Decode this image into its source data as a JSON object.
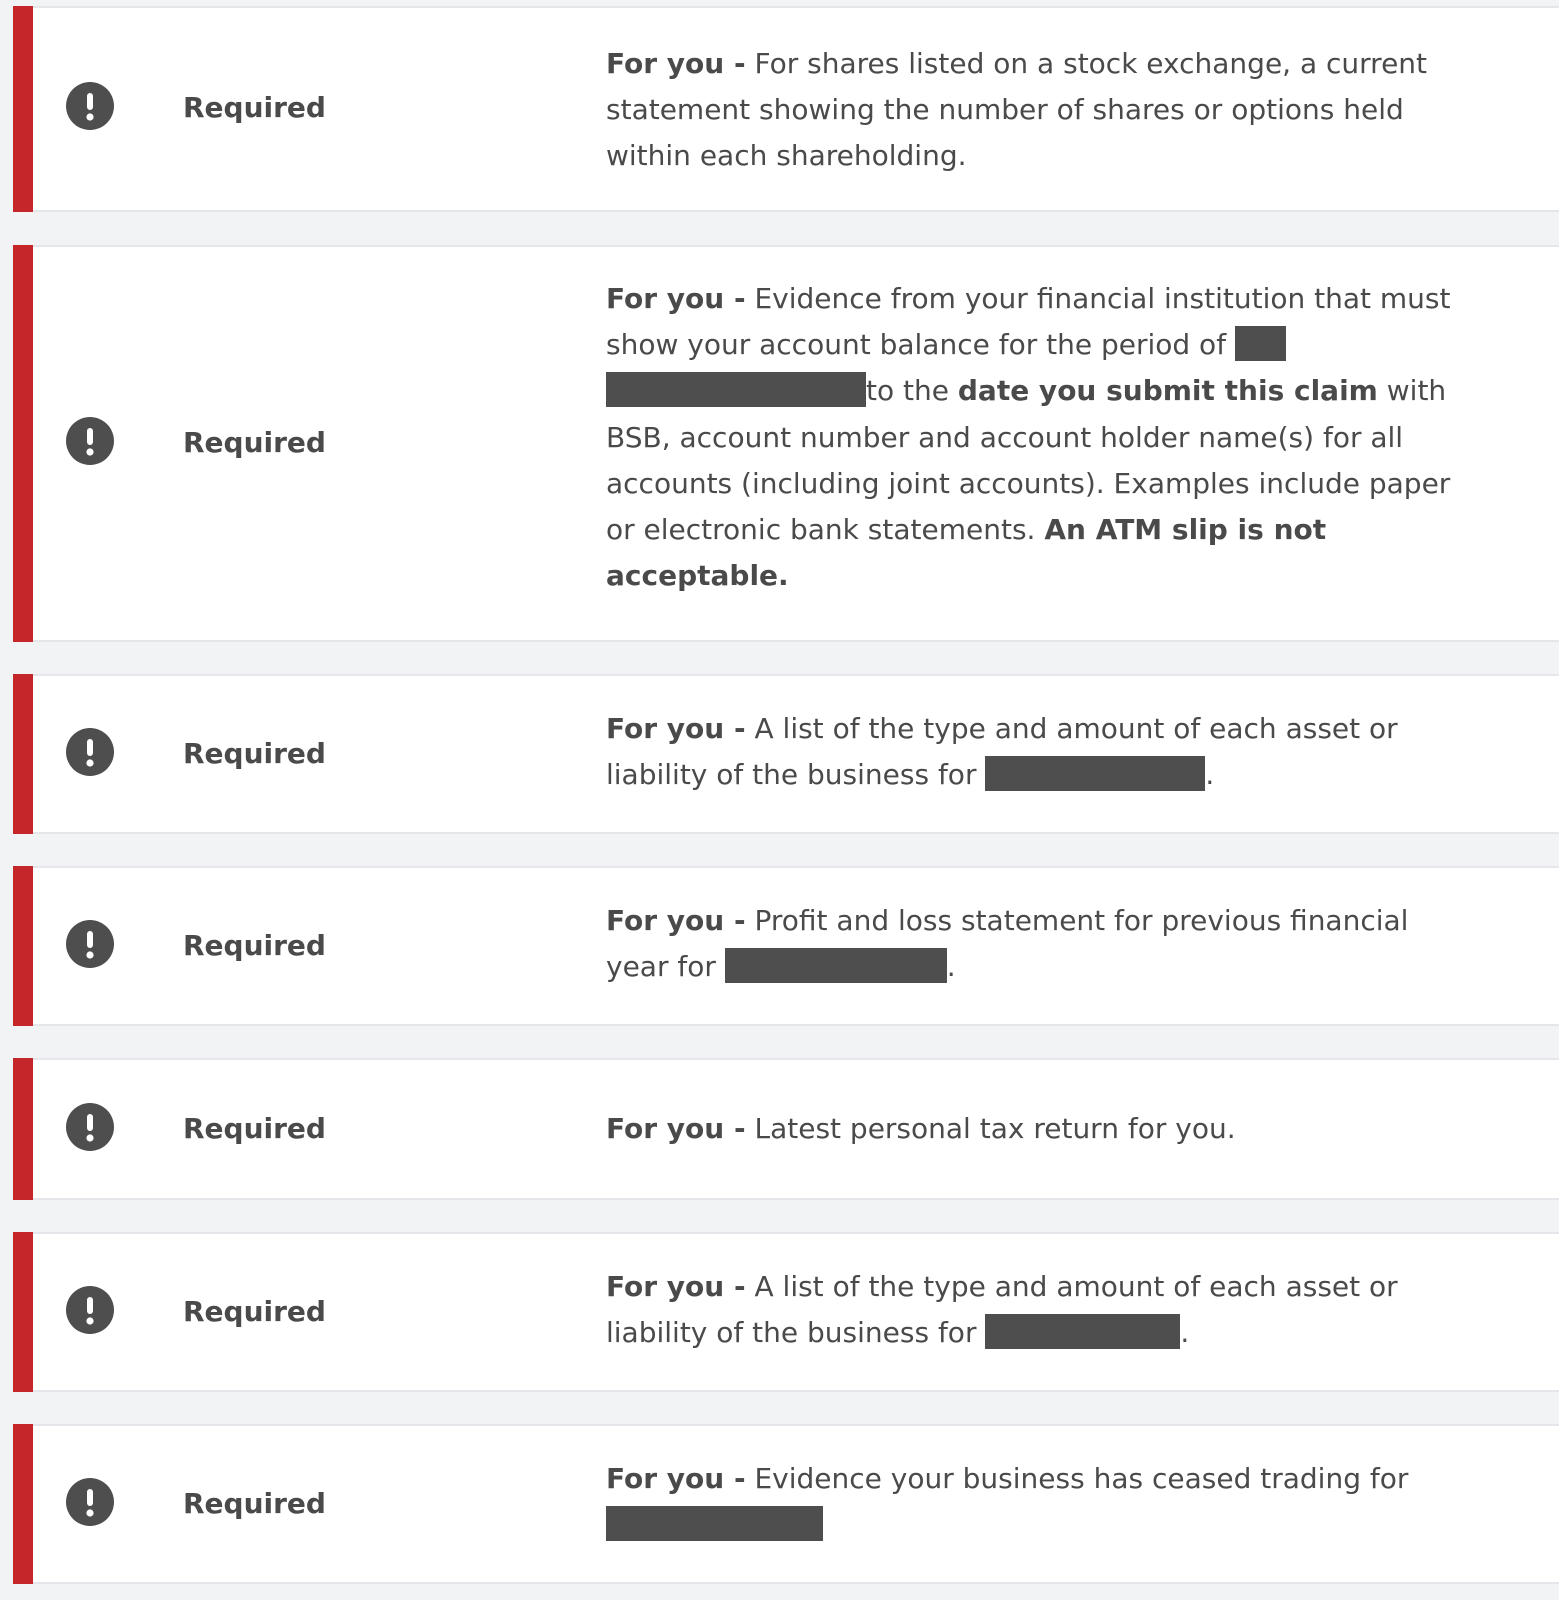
{
  "colors": {
    "accent": "#c4262a",
    "icon": "#4e4e4e",
    "text": "#4a4a4a",
    "background": "#f2f3f5",
    "card": "#ffffff",
    "redaction": "#4e4e4e"
  },
  "icons": {
    "status": "exclamation-circle-icon"
  },
  "requirements": [
    {
      "status": "Required",
      "who": "For you -",
      "text": "For shares listed on a stock exchange, a current statement showing the number of shares or options held within each shareholding."
    },
    {
      "status": "Required",
      "who": "For you -",
      "text_1": "Evidence from your financial institution that must show your account balance for the period of",
      "text_2": "to the",
      "text_bold_1": "date you submit this claim",
      "text_3": "with BSB, account number and account holder name(s) for all accounts (including joint accounts). Examples include paper or electronic bank statements.",
      "text_bold_2": "An ATM slip is not acceptable."
    },
    {
      "status": "Required",
      "who": "For you -",
      "text": "A list of the type and amount of each asset or liability of the business for",
      "suffix": "."
    },
    {
      "status": "Required",
      "who": "For you -",
      "text": "Profit and loss statement for previous financial year for",
      "suffix": "."
    },
    {
      "status": "Required",
      "who": "For you -",
      "text": "Latest personal tax return for you."
    },
    {
      "status": "Required",
      "who": "For you -",
      "text": "A list of the type and amount of each asset or liability of the business for",
      "suffix": "."
    },
    {
      "status": "Required",
      "who": "For you -",
      "text": "Evidence your business has ceased trading for"
    }
  ]
}
